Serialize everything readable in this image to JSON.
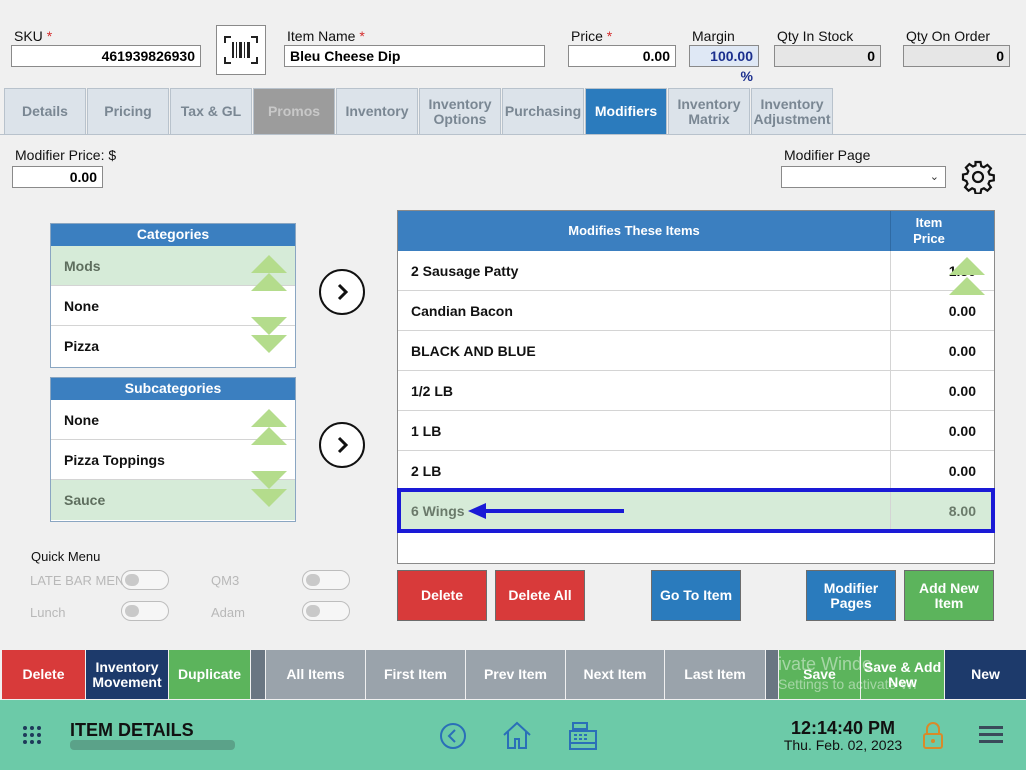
{
  "header": {
    "sku_label": "SKU",
    "sku_value": "461939826930",
    "item_name_label": "Item Name",
    "item_name_value": "Bleu Cheese Dip",
    "price_label": "Price",
    "price_value": "0.00",
    "margin_label": "Margin",
    "margin_value": "100.00 %",
    "qty_in_stock_label": "Qty In Stock",
    "qty_in_stock_value": "0",
    "qty_on_order_label": "Qty On Order",
    "qty_on_order_value": "0",
    "required_mark": "*"
  },
  "tabs": [
    {
      "label": "Details"
    },
    {
      "label": "Pricing"
    },
    {
      "label": "Tax & GL"
    },
    {
      "label": "Promos"
    },
    {
      "label": "Inventory"
    },
    {
      "label": "Inventory Options"
    },
    {
      "label": "Purchasing"
    },
    {
      "label": "Modifiers"
    },
    {
      "label": "Inventory Matrix"
    },
    {
      "label": "Inventory Adjustment"
    }
  ],
  "modifier": {
    "price_label": "Modifier Price: $",
    "price_value": "0.00",
    "page_label": "Modifier Page",
    "page_value": ""
  },
  "categories": {
    "title": "Categories",
    "items": [
      "Mods",
      "None",
      "Pizza"
    ]
  },
  "subcategories": {
    "title": "Subcategories",
    "items": [
      "None",
      "Pizza Toppings",
      "Sauce"
    ]
  },
  "grid": {
    "col_item": "Modifies These Items",
    "col_price": "Item Price",
    "rows": [
      {
        "name": "2 Sausage Patty",
        "price": "1.50"
      },
      {
        "name": "Candian Bacon",
        "price": "0.00"
      },
      {
        "name": "BLACK AND BLUE",
        "price": "0.00"
      },
      {
        "name": "1/2 LB",
        "price": "0.00"
      },
      {
        "name": "1 LB",
        "price": "0.00"
      },
      {
        "name": "2 LB",
        "price": "0.00"
      },
      {
        "name": "6 Wings",
        "price": "8.00"
      }
    ]
  },
  "actions": {
    "delete": "Delete",
    "delete_all": "Delete All",
    "go_to_item": "Go To Item",
    "modifier_pages": "Modifier Pages",
    "add_new_item": "Add New Item"
  },
  "quick_menu": {
    "title": "Quick Menu",
    "items": [
      "LATE BAR MENU",
      "QM3",
      "Lunch",
      "Adam"
    ]
  },
  "bottom_bar": {
    "delete": "Delete",
    "inventory_movement": "Inventory Movement",
    "duplicate": "Duplicate",
    "all_items": "All Items",
    "first_item": "First Item",
    "prev_item": "Prev Item",
    "next_item": "Next Item",
    "last_item": "Last Item",
    "save": "Save",
    "save_add_new": "Save & Add New",
    "new": "New",
    "watermark_line1": "ivate Windo",
    "watermark_line2": "Settings to activate Wi"
  },
  "footer": {
    "title": "ITEM DETAILS",
    "time": "12:14:40 PM",
    "date": "Thu. Feb. 02, 2023"
  },
  "colors": {
    "accent_blue": "#2b7bbd",
    "delete_red": "#d83a3a",
    "add_green": "#5cb45c",
    "footer_teal": "#6ccaa8",
    "highlight_border": "#1a1ad6"
  }
}
